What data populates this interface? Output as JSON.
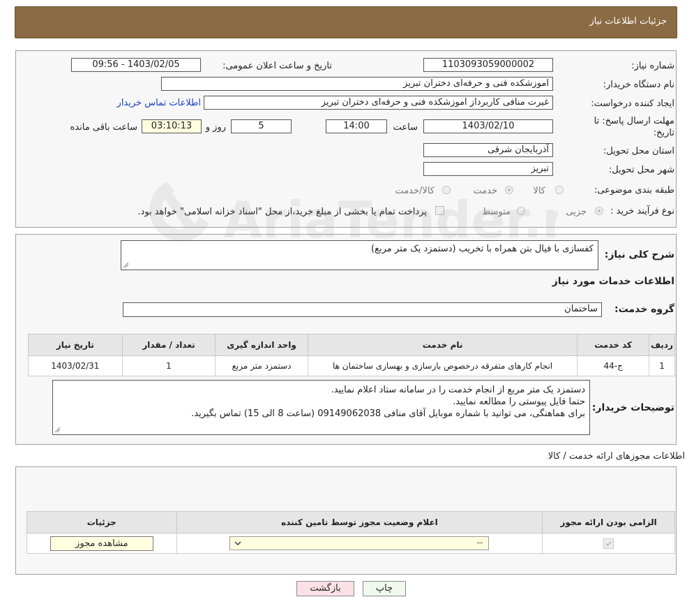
{
  "header": {
    "title": "جزئیات اطلاعات نیاز"
  },
  "form": {
    "need_number_label": "شماره نیاز:",
    "need_number": "1103093059000002",
    "announce_label": "تاریخ و ساعت اعلان عمومی:",
    "announce_value": "1403/02/05 - 09:56",
    "buyer_org_label": "نام دستگاه خریدار:",
    "buyer_org": "اموزشکده فنی و حرفه‌ای دختران تبریز",
    "creator_label": "ایجاد کننده درخواست:",
    "creator": "غیرت منافی کاربرداز اموزشکده فنی و حرفه‌ای دختران تبریز",
    "contact_link": "اطلاعات تماس خریدار",
    "deadline_label_1": "مهلت ارسال پاسخ: تا",
    "deadline_label_2": "تاریخ:",
    "deadline_date": "1403/02/10",
    "time_label": "ساعت",
    "deadline_time": "14:00",
    "days": "5",
    "days_label": "روز و",
    "remaining": "03:10:13",
    "remaining_label": "ساعت باقی مانده",
    "province_label": "استان محل تحویل:",
    "province": "آذربایجان شرقی",
    "city_label": "شهر محل تحویل:",
    "city": "تبریز",
    "category_label": "طبقه بندی موضوعی:",
    "category_options": [
      "کالا",
      "خدمت",
      "کالا/خدمت"
    ],
    "process_label": "نوع فرآیند خرید :",
    "process_options": [
      "جزیی",
      "متوسط"
    ],
    "process_note": "پرداخت تمام یا بخشی از مبلغ خرید،از محل \"اسناد خزانه اسلامی\" خواهد بود."
  },
  "details": {
    "summary_label": "شرح کلی نیاز:",
    "summary": "کفسازی با فیال بتن همراه با تخریب (دستمزد یک متر مربع)",
    "services_title": "اطلاعات خدمات مورد نیاز",
    "service_group_label": "گروه خدمت:",
    "service_group": "ساختمان",
    "table": {
      "headers": [
        "ردیف",
        "کد خدمت",
        "نام خدمت",
        "واحد اندازه گیری",
        "تعداد / مقدار",
        "تاریخ نیاز"
      ],
      "rows": [
        [
          "1",
          "ج-44",
          "انجام کارهای متفرقه درخصوص بازسازی و بهسازی ساختمان ها",
          "دستمزد متر مربع",
          "1",
          "1403/02/31"
        ]
      ]
    },
    "buyer_notes_label": "توضیحات خریدار:",
    "buyer_notes": [
      "دستمزد یک متر مربع از انجام خدمت را در سامانه ستاد اعلام نمایید.",
      "حتما فایل پیوستی را مطالعه نمایید.",
      "برای هماهنگی، می توانید با شماره موبایل آقای منافی 09149062038 (ساعت 8 الی 15) تماس بگیرید."
    ]
  },
  "permits": {
    "title": "اطلاعات مجوزهای ارائه خدمت / کالا",
    "headers": [
      "الزامی بودن ارائه مجوز",
      "اعلام وضعیت مجوز توسط تامین کننده",
      "جزئیات"
    ],
    "select_value": "--",
    "view_button": "مشاهده مجوز"
  },
  "actions": {
    "print": "چاپ",
    "back": "بازگشت"
  },
  "watermark": "AriaTender.neT"
}
